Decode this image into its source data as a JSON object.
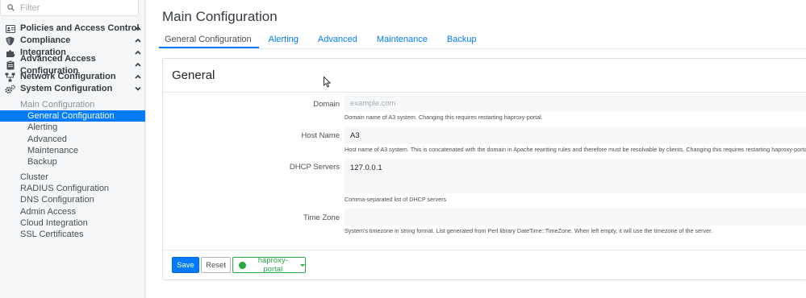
{
  "sidebar": {
    "filter_placeholder": "Filter",
    "sections": [
      {
        "label": "Policies and Access Control",
        "icon": "id-card-icon",
        "expanded": false
      },
      {
        "label": "Compliance",
        "icon": "shield-icon",
        "expanded": false
      },
      {
        "label": "Integration",
        "icon": "puzzle-icon",
        "expanded": false
      },
      {
        "label": "Advanced Access Configuration",
        "icon": "clipboard-icon",
        "expanded": false
      },
      {
        "label": "Network Configuration",
        "icon": "network-icon",
        "expanded": false
      },
      {
        "label": "System Configuration",
        "icon": "cogs-icon",
        "expanded": true
      }
    ],
    "group_label": "Main Configuration",
    "main_items": [
      "General Configuration",
      "Alerting",
      "Advanced",
      "Maintenance",
      "Backup"
    ],
    "other_items": [
      "Cluster",
      "RADIUS Configuration",
      "DNS Configuration",
      "Admin Access",
      "Cloud Integration",
      "SSL Certificates"
    ]
  },
  "main": {
    "title": "Main Configuration",
    "tabs": [
      "General Configuration",
      "Alerting",
      "Advanced",
      "Maintenance",
      "Backup"
    ],
    "active_tab": "General Configuration",
    "card_title": "General",
    "fields": {
      "domain": {
        "label": "Domain",
        "placeholder": "example.com",
        "value": "",
        "help": "Domain name of A3 system. Changing this requires restarting haproxy-portal."
      },
      "hostname": {
        "label": "Host Name",
        "value": "A3",
        "help": "Host name of A3 system. This is concatenated with the domain in Apache rewriting rules and therefore must be resolvable by clients. Changing this requires restarting haproxy-portal."
      },
      "dhcp": {
        "label": "DHCP Servers",
        "value": "127.0.0.1",
        "help": "Comma-separated list of DHCP servers"
      },
      "timezone": {
        "label": "Time Zone",
        "value": "",
        "help": "System's timezone in string format. List generated from Perl library DateTime::TimeZone. When left empty, it will use the timezone of the server."
      }
    },
    "buttons": {
      "save": "Save",
      "reset": "Reset",
      "service": "haproxy-portal"
    }
  },
  "colors": {
    "accent": "#007bff",
    "success": "#28a745",
    "sidebar_bg": "#f5f6f8"
  }
}
